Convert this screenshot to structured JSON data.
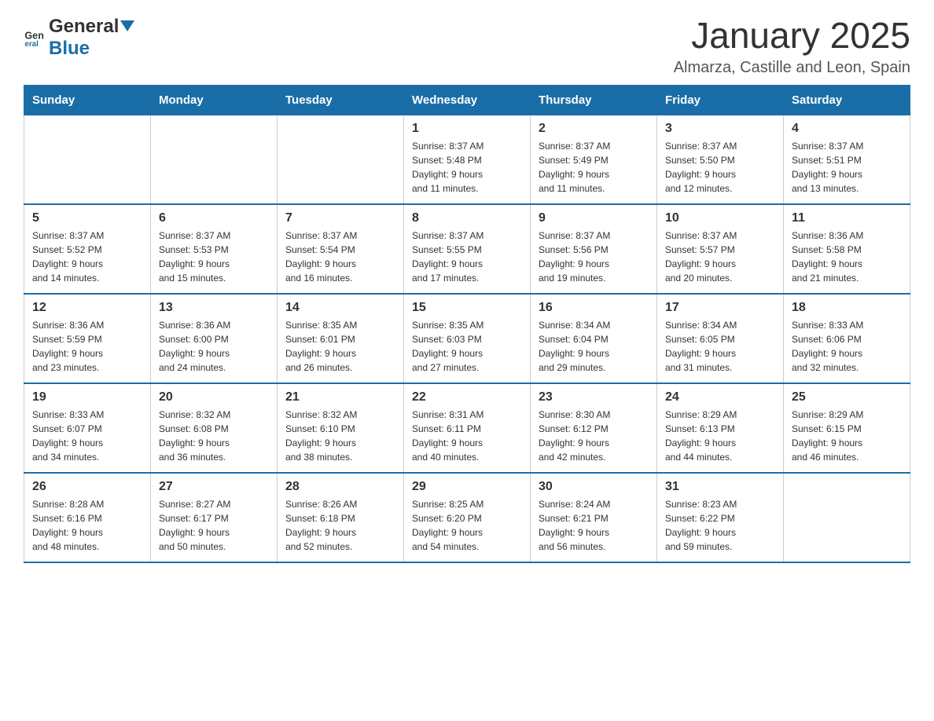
{
  "header": {
    "logo_general": "General",
    "logo_blue": "Blue",
    "title": "January 2025",
    "subtitle": "Almarza, Castille and Leon, Spain"
  },
  "weekdays": [
    "Sunday",
    "Monday",
    "Tuesday",
    "Wednesday",
    "Thursday",
    "Friday",
    "Saturday"
  ],
  "weeks": [
    [
      {
        "day": "",
        "info": ""
      },
      {
        "day": "",
        "info": ""
      },
      {
        "day": "",
        "info": ""
      },
      {
        "day": "1",
        "info": "Sunrise: 8:37 AM\nSunset: 5:48 PM\nDaylight: 9 hours\nand 11 minutes."
      },
      {
        "day": "2",
        "info": "Sunrise: 8:37 AM\nSunset: 5:49 PM\nDaylight: 9 hours\nand 11 minutes."
      },
      {
        "day": "3",
        "info": "Sunrise: 8:37 AM\nSunset: 5:50 PM\nDaylight: 9 hours\nand 12 minutes."
      },
      {
        "day": "4",
        "info": "Sunrise: 8:37 AM\nSunset: 5:51 PM\nDaylight: 9 hours\nand 13 minutes."
      }
    ],
    [
      {
        "day": "5",
        "info": "Sunrise: 8:37 AM\nSunset: 5:52 PM\nDaylight: 9 hours\nand 14 minutes."
      },
      {
        "day": "6",
        "info": "Sunrise: 8:37 AM\nSunset: 5:53 PM\nDaylight: 9 hours\nand 15 minutes."
      },
      {
        "day": "7",
        "info": "Sunrise: 8:37 AM\nSunset: 5:54 PM\nDaylight: 9 hours\nand 16 minutes."
      },
      {
        "day": "8",
        "info": "Sunrise: 8:37 AM\nSunset: 5:55 PM\nDaylight: 9 hours\nand 17 minutes."
      },
      {
        "day": "9",
        "info": "Sunrise: 8:37 AM\nSunset: 5:56 PM\nDaylight: 9 hours\nand 19 minutes."
      },
      {
        "day": "10",
        "info": "Sunrise: 8:37 AM\nSunset: 5:57 PM\nDaylight: 9 hours\nand 20 minutes."
      },
      {
        "day": "11",
        "info": "Sunrise: 8:36 AM\nSunset: 5:58 PM\nDaylight: 9 hours\nand 21 minutes."
      }
    ],
    [
      {
        "day": "12",
        "info": "Sunrise: 8:36 AM\nSunset: 5:59 PM\nDaylight: 9 hours\nand 23 minutes."
      },
      {
        "day": "13",
        "info": "Sunrise: 8:36 AM\nSunset: 6:00 PM\nDaylight: 9 hours\nand 24 minutes."
      },
      {
        "day": "14",
        "info": "Sunrise: 8:35 AM\nSunset: 6:01 PM\nDaylight: 9 hours\nand 26 minutes."
      },
      {
        "day": "15",
        "info": "Sunrise: 8:35 AM\nSunset: 6:03 PM\nDaylight: 9 hours\nand 27 minutes."
      },
      {
        "day": "16",
        "info": "Sunrise: 8:34 AM\nSunset: 6:04 PM\nDaylight: 9 hours\nand 29 minutes."
      },
      {
        "day": "17",
        "info": "Sunrise: 8:34 AM\nSunset: 6:05 PM\nDaylight: 9 hours\nand 31 minutes."
      },
      {
        "day": "18",
        "info": "Sunrise: 8:33 AM\nSunset: 6:06 PM\nDaylight: 9 hours\nand 32 minutes."
      }
    ],
    [
      {
        "day": "19",
        "info": "Sunrise: 8:33 AM\nSunset: 6:07 PM\nDaylight: 9 hours\nand 34 minutes."
      },
      {
        "day": "20",
        "info": "Sunrise: 8:32 AM\nSunset: 6:08 PM\nDaylight: 9 hours\nand 36 minutes."
      },
      {
        "day": "21",
        "info": "Sunrise: 8:32 AM\nSunset: 6:10 PM\nDaylight: 9 hours\nand 38 minutes."
      },
      {
        "day": "22",
        "info": "Sunrise: 8:31 AM\nSunset: 6:11 PM\nDaylight: 9 hours\nand 40 minutes."
      },
      {
        "day": "23",
        "info": "Sunrise: 8:30 AM\nSunset: 6:12 PM\nDaylight: 9 hours\nand 42 minutes."
      },
      {
        "day": "24",
        "info": "Sunrise: 8:29 AM\nSunset: 6:13 PM\nDaylight: 9 hours\nand 44 minutes."
      },
      {
        "day": "25",
        "info": "Sunrise: 8:29 AM\nSunset: 6:15 PM\nDaylight: 9 hours\nand 46 minutes."
      }
    ],
    [
      {
        "day": "26",
        "info": "Sunrise: 8:28 AM\nSunset: 6:16 PM\nDaylight: 9 hours\nand 48 minutes."
      },
      {
        "day": "27",
        "info": "Sunrise: 8:27 AM\nSunset: 6:17 PM\nDaylight: 9 hours\nand 50 minutes."
      },
      {
        "day": "28",
        "info": "Sunrise: 8:26 AM\nSunset: 6:18 PM\nDaylight: 9 hours\nand 52 minutes."
      },
      {
        "day": "29",
        "info": "Sunrise: 8:25 AM\nSunset: 6:20 PM\nDaylight: 9 hours\nand 54 minutes."
      },
      {
        "day": "30",
        "info": "Sunrise: 8:24 AM\nSunset: 6:21 PM\nDaylight: 9 hours\nand 56 minutes."
      },
      {
        "day": "31",
        "info": "Sunrise: 8:23 AM\nSunset: 6:22 PM\nDaylight: 9 hours\nand 59 minutes."
      },
      {
        "day": "",
        "info": ""
      }
    ]
  ]
}
